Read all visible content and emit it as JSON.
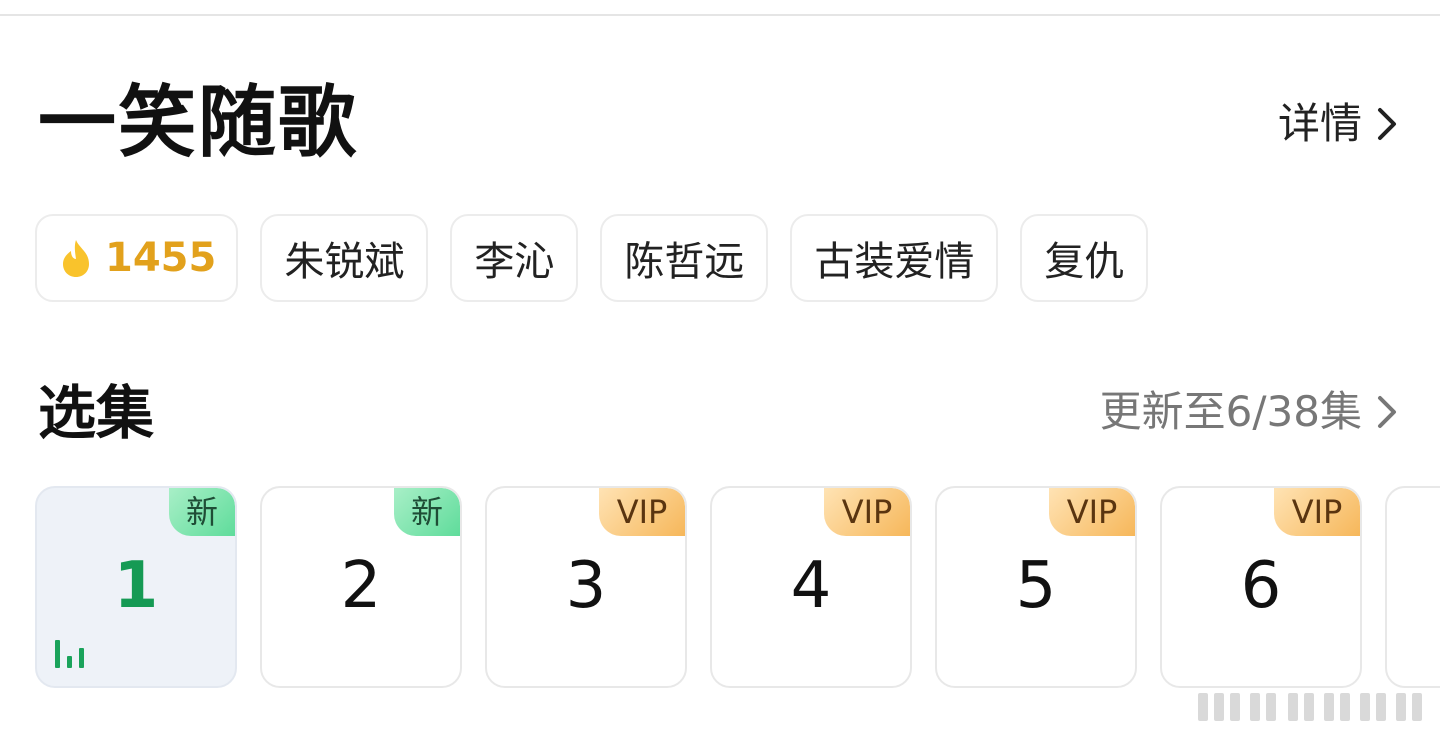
{
  "header": {
    "title": "一笑随歌",
    "detail_label": "详情"
  },
  "tags": [
    {
      "label": "1455",
      "icon": "flame-icon",
      "color": "#e2a11c"
    },
    {
      "label": "朱锐斌"
    },
    {
      "label": "李沁"
    },
    {
      "label": "陈哲远"
    },
    {
      "label": "古装爱情"
    },
    {
      "label": "复仇"
    }
  ],
  "episodes_section": {
    "title": "选集",
    "update_label": "更新至6/38集"
  },
  "episodes": [
    {
      "number": "1",
      "badge": "新",
      "active": true
    },
    {
      "number": "2",
      "badge": "新"
    },
    {
      "number": "3",
      "badge": "VIP"
    },
    {
      "number": "4",
      "badge": "VIP"
    },
    {
      "number": "5",
      "badge": "VIP"
    },
    {
      "number": "6",
      "badge": "VIP"
    }
  ],
  "colors": {
    "active_episode": "#159a54",
    "new_badge": "#6ee0a3",
    "vip_badge": "#f6b75a"
  }
}
